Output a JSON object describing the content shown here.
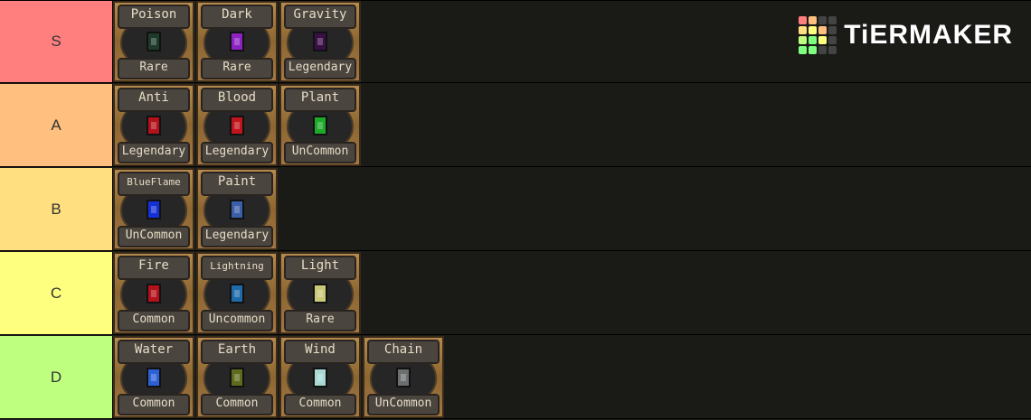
{
  "logo": {
    "text": "TiERMAKER",
    "grid_colors": [
      "#ff7f7f",
      "#ffbf7f",
      "#444444",
      "#444444",
      "#ffdf7f",
      "#ffff7f",
      "#ffbf7f",
      "#444444",
      "#bfff7f",
      "#7fff7f",
      "#ffff7f",
      "#444444",
      "#7fff7f",
      "#7fff7f",
      "#444444",
      "#444444"
    ]
  },
  "tiers": [
    {
      "label": "S",
      "color": "#ff7f7f",
      "items": [
        {
          "name": "Poison",
          "rarity": "Rare",
          "gem": "#1e3a2a"
        },
        {
          "name": "Dark",
          "rarity": "Rare",
          "gem": "#8d22c2"
        },
        {
          "name": "Gravity",
          "rarity": "Legendary",
          "gem": "#3a0f46"
        }
      ]
    },
    {
      "label": "A",
      "color": "#ffbf7f",
      "items": [
        {
          "name": "Anti",
          "rarity": "Legendary",
          "gem": "#b3111b"
        },
        {
          "name": "Blood",
          "rarity": "Legendary",
          "gem": "#c2141b"
        },
        {
          "name": "Plant",
          "rarity": "UnCommon",
          "gem": "#1ea92a"
        }
      ]
    },
    {
      "label": "B",
      "color": "#ffdf7f",
      "items": [
        {
          "name": "BlueFlame",
          "rarity": "UnCommon",
          "gem": "#1531d6",
          "small": true
        },
        {
          "name": "Paint",
          "rarity": "Legendary",
          "gem": "#3b5ea8"
        }
      ]
    },
    {
      "label": "C",
      "color": "#ffff7f",
      "items": [
        {
          "name": "Fire",
          "rarity": "Common",
          "gem": "#b3111b"
        },
        {
          "name": "Lightning",
          "rarity": "Uncommon",
          "gem": "#1f6aa8",
          "small": true
        },
        {
          "name": "Light",
          "rarity": "Rare",
          "gem": "#c9c97a"
        }
      ]
    },
    {
      "label": "D",
      "color": "#bfff7f",
      "items": [
        {
          "name": "Water",
          "rarity": "Common",
          "gem": "#2d5fd6"
        },
        {
          "name": "Earth",
          "rarity": "Common",
          "gem": "#5f6b1c"
        },
        {
          "name": "Wind",
          "rarity": "Common",
          "gem": "#a9d9d3"
        },
        {
          "name": "Chain",
          "rarity": "UnCommon",
          "gem": "#6b6f6f"
        }
      ]
    }
  ]
}
